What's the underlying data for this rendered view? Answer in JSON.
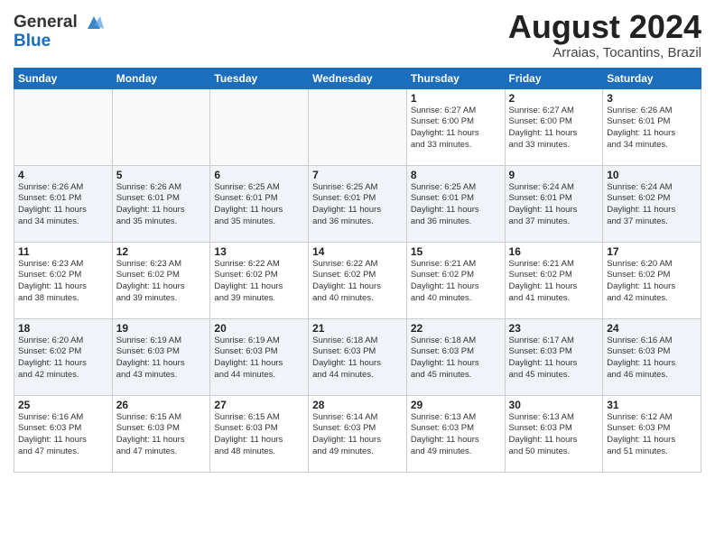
{
  "header": {
    "logo_line1": "General",
    "logo_line2": "Blue",
    "month_title": "August 2024",
    "subtitle": "Arraias, Tocantins, Brazil"
  },
  "weekdays": [
    "Sunday",
    "Monday",
    "Tuesday",
    "Wednesday",
    "Thursday",
    "Friday",
    "Saturday"
  ],
  "weeks": [
    [
      {
        "day": "",
        "detail": ""
      },
      {
        "day": "",
        "detail": ""
      },
      {
        "day": "",
        "detail": ""
      },
      {
        "day": "",
        "detail": ""
      },
      {
        "day": "1",
        "detail": "Sunrise: 6:27 AM\nSunset: 6:00 PM\nDaylight: 11 hours\nand 33 minutes."
      },
      {
        "day": "2",
        "detail": "Sunrise: 6:27 AM\nSunset: 6:00 PM\nDaylight: 11 hours\nand 33 minutes."
      },
      {
        "day": "3",
        "detail": "Sunrise: 6:26 AM\nSunset: 6:01 PM\nDaylight: 11 hours\nand 34 minutes."
      }
    ],
    [
      {
        "day": "4",
        "detail": "Sunrise: 6:26 AM\nSunset: 6:01 PM\nDaylight: 11 hours\nand 34 minutes."
      },
      {
        "day": "5",
        "detail": "Sunrise: 6:26 AM\nSunset: 6:01 PM\nDaylight: 11 hours\nand 35 minutes."
      },
      {
        "day": "6",
        "detail": "Sunrise: 6:25 AM\nSunset: 6:01 PM\nDaylight: 11 hours\nand 35 minutes."
      },
      {
        "day": "7",
        "detail": "Sunrise: 6:25 AM\nSunset: 6:01 PM\nDaylight: 11 hours\nand 36 minutes."
      },
      {
        "day": "8",
        "detail": "Sunrise: 6:25 AM\nSunset: 6:01 PM\nDaylight: 11 hours\nand 36 minutes."
      },
      {
        "day": "9",
        "detail": "Sunrise: 6:24 AM\nSunset: 6:01 PM\nDaylight: 11 hours\nand 37 minutes."
      },
      {
        "day": "10",
        "detail": "Sunrise: 6:24 AM\nSunset: 6:02 PM\nDaylight: 11 hours\nand 37 minutes."
      }
    ],
    [
      {
        "day": "11",
        "detail": "Sunrise: 6:23 AM\nSunset: 6:02 PM\nDaylight: 11 hours\nand 38 minutes."
      },
      {
        "day": "12",
        "detail": "Sunrise: 6:23 AM\nSunset: 6:02 PM\nDaylight: 11 hours\nand 39 minutes."
      },
      {
        "day": "13",
        "detail": "Sunrise: 6:22 AM\nSunset: 6:02 PM\nDaylight: 11 hours\nand 39 minutes."
      },
      {
        "day": "14",
        "detail": "Sunrise: 6:22 AM\nSunset: 6:02 PM\nDaylight: 11 hours\nand 40 minutes."
      },
      {
        "day": "15",
        "detail": "Sunrise: 6:21 AM\nSunset: 6:02 PM\nDaylight: 11 hours\nand 40 minutes."
      },
      {
        "day": "16",
        "detail": "Sunrise: 6:21 AM\nSunset: 6:02 PM\nDaylight: 11 hours\nand 41 minutes."
      },
      {
        "day": "17",
        "detail": "Sunrise: 6:20 AM\nSunset: 6:02 PM\nDaylight: 11 hours\nand 42 minutes."
      }
    ],
    [
      {
        "day": "18",
        "detail": "Sunrise: 6:20 AM\nSunset: 6:02 PM\nDaylight: 11 hours\nand 42 minutes."
      },
      {
        "day": "19",
        "detail": "Sunrise: 6:19 AM\nSunset: 6:03 PM\nDaylight: 11 hours\nand 43 minutes."
      },
      {
        "day": "20",
        "detail": "Sunrise: 6:19 AM\nSunset: 6:03 PM\nDaylight: 11 hours\nand 44 minutes."
      },
      {
        "day": "21",
        "detail": "Sunrise: 6:18 AM\nSunset: 6:03 PM\nDaylight: 11 hours\nand 44 minutes."
      },
      {
        "day": "22",
        "detail": "Sunrise: 6:18 AM\nSunset: 6:03 PM\nDaylight: 11 hours\nand 45 minutes."
      },
      {
        "day": "23",
        "detail": "Sunrise: 6:17 AM\nSunset: 6:03 PM\nDaylight: 11 hours\nand 45 minutes."
      },
      {
        "day": "24",
        "detail": "Sunrise: 6:16 AM\nSunset: 6:03 PM\nDaylight: 11 hours\nand 46 minutes."
      }
    ],
    [
      {
        "day": "25",
        "detail": "Sunrise: 6:16 AM\nSunset: 6:03 PM\nDaylight: 11 hours\nand 47 minutes."
      },
      {
        "day": "26",
        "detail": "Sunrise: 6:15 AM\nSunset: 6:03 PM\nDaylight: 11 hours\nand 47 minutes."
      },
      {
        "day": "27",
        "detail": "Sunrise: 6:15 AM\nSunset: 6:03 PM\nDaylight: 11 hours\nand 48 minutes."
      },
      {
        "day": "28",
        "detail": "Sunrise: 6:14 AM\nSunset: 6:03 PM\nDaylight: 11 hours\nand 49 minutes."
      },
      {
        "day": "29",
        "detail": "Sunrise: 6:13 AM\nSunset: 6:03 PM\nDaylight: 11 hours\nand 49 minutes."
      },
      {
        "day": "30",
        "detail": "Sunrise: 6:13 AM\nSunset: 6:03 PM\nDaylight: 11 hours\nand 50 minutes."
      },
      {
        "day": "31",
        "detail": "Sunrise: 6:12 AM\nSunset: 6:03 PM\nDaylight: 11 hours\nand 51 minutes."
      }
    ]
  ]
}
